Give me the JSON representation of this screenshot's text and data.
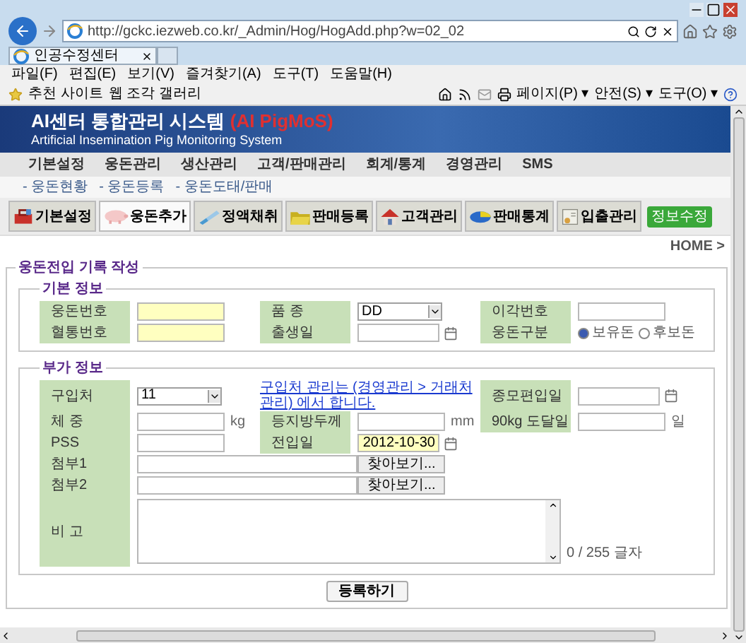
{
  "browser": {
    "url": "http://gckc.iezweb.co.kr/_Admin/Hog/HogAdd.php?w=02_02",
    "tab": "인공수정센터",
    "menu": [
      "파일(F)",
      "편집(E)",
      "보기(V)",
      "즐겨찾기(A)",
      "도구(T)",
      "도움말(H)"
    ],
    "favorites": [
      "추천 사이트",
      "웹 조각 갤러리"
    ],
    "command_bar": [
      "페이지(P) ▾",
      "안전(S) ▾",
      "도구(O) ▾"
    ]
  },
  "banner": {
    "title": "AI센터 통합관리 시스템",
    "title_suffix": "(AI PigMoS)",
    "subtitle": "Artificial Insemination Pig Monitoring System"
  },
  "nav": [
    "기본설정",
    "웅돈관리",
    "생산관리",
    "고객/판매관리",
    "회계/통계",
    "경영관리",
    "SMS"
  ],
  "subnav": [
    "- 웅돈현황",
    "- 웅돈등록",
    "- 웅돈도태/판매"
  ],
  "toolbar": [
    {
      "label": "기본설정",
      "selected": false
    },
    {
      "label": "웅돈추가",
      "selected": true
    },
    {
      "label": "정액채취",
      "selected": false
    },
    {
      "label": "판매등록",
      "selected": false
    },
    {
      "label": "고객관리",
      "selected": false
    },
    {
      "label": "판매통계",
      "selected": false
    },
    {
      "label": "입출관리",
      "selected": false
    }
  ],
  "toolbar_extra": "정보수정",
  "breadcrumb": "HOME >",
  "form": {
    "title": "웅돈전입 기록 작성",
    "submit": "등록하기",
    "sections": [
      {
        "title": "기본 정보",
        "rows": [
          [
            {
              "label": "웅돈번호",
              "field": {
                "kind": "text",
                "highlighted": true
              }
            },
            {
              "label": "품 종",
              "field": {
                "kind": "select",
                "value": "DD"
              }
            },
            {
              "label": "이각번호",
              "field": {
                "kind": "text",
                "highlighted": false
              }
            }
          ],
          [
            {
              "label": "혈통번호",
              "field": {
                "kind": "text",
                "highlighted": true
              }
            },
            {
              "label": "출생일",
              "field": {
                "kind": "date",
                "highlighted": false
              }
            },
            {
              "label": "웅돈구분",
              "field": {
                "kind": "radio",
                "options": [
                  {
                    "label": "보유돈",
                    "selected": true
                  },
                  {
                    "label": "후보돈",
                    "selected": false
                  }
                ]
              }
            }
          ]
        ]
      },
      {
        "title": "부가 정보",
        "rows": [
          [
            {
              "label": "구입처",
              "field": {
                "kind": "select",
                "value": "11"
              }
            },
            {
              "kind": "link",
              "text": "구입처 관리는 (경영관리 > 거래처관리) 에서 합니다."
            },
            {
              "label": "종모편입일",
              "field": {
                "kind": "date",
                "highlighted": false
              }
            }
          ],
          [
            {
              "label": "체 중",
              "field": {
                "kind": "text",
                "unit": "kg",
                "highlighted": false
              }
            },
            {
              "label": "등지방두께",
              "field": {
                "kind": "text",
                "unit": "mm",
                "highlighted": false
              }
            },
            {
              "label": "90kg 도달일",
              "field": {
                "kind": "text",
                "unit": "일",
                "highlighted": false
              }
            }
          ],
          [
            {
              "label": "PSS",
              "field": {
                "kind": "text",
                "highlighted": false
              }
            },
            {
              "label": "전입일",
              "field": {
                "kind": "date",
                "value": "2012-10-30",
                "highlighted": true
              }
            }
          ],
          [
            {
              "label": "첨부1",
              "field": {
                "kind": "file",
                "button": "찾아보기..."
              }
            }
          ],
          [
            {
              "label": "첨부2",
              "field": {
                "kind": "file",
                "button": "찾아보기..."
              }
            }
          ],
          [
            {
              "label": "비 고",
              "field": {
                "kind": "textarea",
                "counter": "0 / 255 글자"
              }
            }
          ]
        ]
      }
    ]
  }
}
